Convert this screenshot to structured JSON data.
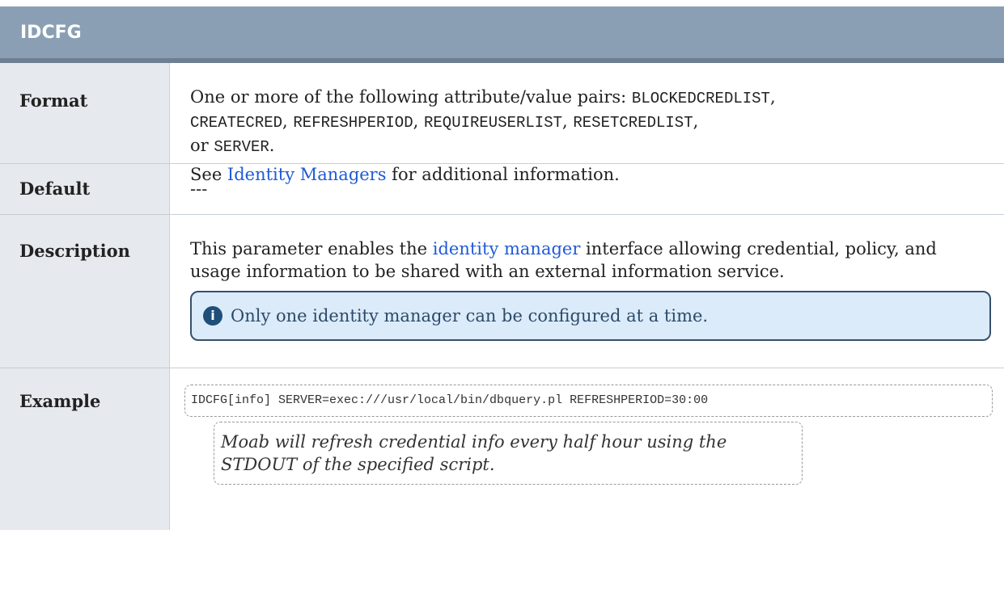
{
  "title": "IDCFG",
  "format": {
    "label": "Format",
    "intro": "One or more of the following attribute/value pairs: ",
    "attrs": [
      "BLOCKEDCREDLIST",
      "CREATECRED",
      "REFRESHPERIOD",
      "REQUIREUSERLIST",
      "RESETCREDLIST",
      "SERVER"
    ],
    "sep": ", ",
    "or": "or ",
    "end": ".",
    "see_prefix": "See ",
    "see_link": "Identity Managers",
    "see_suffix": " for additional information."
  },
  "default": {
    "label": "Default",
    "value": "---"
  },
  "description": {
    "label": "Description",
    "prefix": "This parameter enables the ",
    "link": "identity manager",
    "suffix": " interface allowing credential, policy, and usage information to be shared with an external information service.",
    "note": "Only one identity manager can be configured at a time.",
    "note_icon": "info-icon"
  },
  "example": {
    "label": "Example",
    "code": "IDCFG[info] SERVER=exec:///usr/local/bin/dbquery.pl REFRESHPERIOD=30:00",
    "caption": "Moab will refresh credential info every half hour using the STDOUT of the specified script."
  }
}
